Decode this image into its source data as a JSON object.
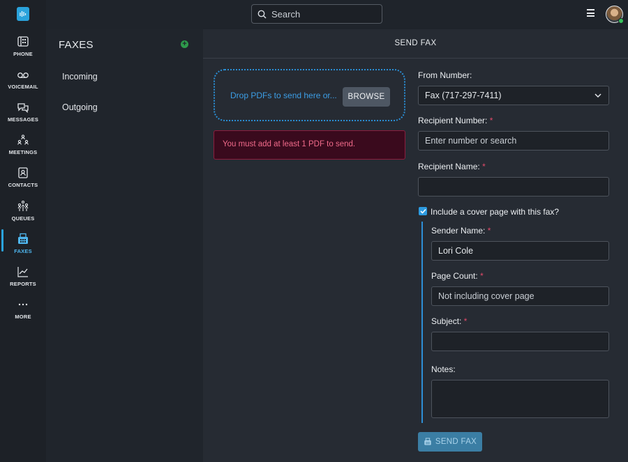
{
  "search": {
    "placeholder": "Search"
  },
  "rail": {
    "items": [
      {
        "label": "PHONE",
        "icon": "phone-icon"
      },
      {
        "label": "VOICEMAIL",
        "icon": "voicemail-icon"
      },
      {
        "label": "MESSAGES",
        "icon": "messages-icon"
      },
      {
        "label": "MEETINGS",
        "icon": "meetings-icon"
      },
      {
        "label": "CONTACTS",
        "icon": "contacts-icon"
      },
      {
        "label": "QUEUES",
        "icon": "queues-icon"
      },
      {
        "label": "FAXES",
        "icon": "fax-icon",
        "active": true
      },
      {
        "label": "REPORTS",
        "icon": "reports-icon"
      },
      {
        "label": "MORE",
        "icon": "more-icon"
      }
    ],
    "accent_color": "#2aa3dc"
  },
  "panel": {
    "title": "FAXES",
    "nav": [
      "Incoming",
      "Outgoing"
    ]
  },
  "main": {
    "title": "SEND FAX",
    "dropzone_text": "Drop PDFs to send here or...",
    "browse_label": "BROWSE",
    "error_text": "You must add at least 1 PDF to send."
  },
  "form": {
    "from_label": "From Number:",
    "from_value": "Fax (717-297-7411)",
    "recipient_number_label": "Recipient Number:",
    "recipient_number_placeholder": "Enter number or search",
    "recipient_name_label": "Recipient Name:",
    "recipient_name_value": "",
    "required_mark": "*",
    "cover_page_label": "Include a cover page with this fax?",
    "cover_page_checked": true,
    "sender_name_label": "Sender Name:",
    "sender_name_value": "Lori Cole",
    "page_count_label": "Page Count:",
    "page_count_placeholder": "Not including cover page",
    "subject_label": "Subject:",
    "subject_value": "",
    "notes_label": "Notes:",
    "notes_value": "",
    "send_label": "SEND FAX"
  }
}
